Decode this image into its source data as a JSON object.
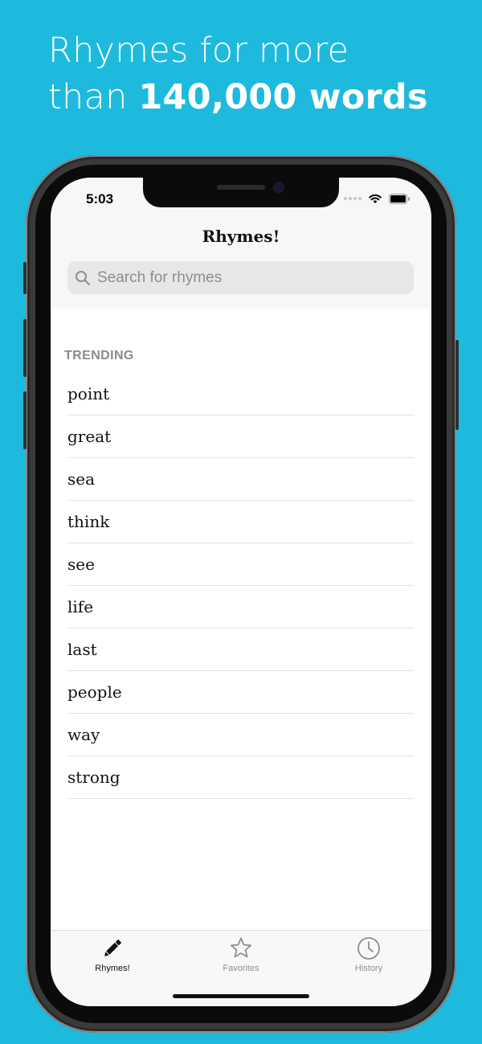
{
  "headline": {
    "line1": "Rhymes for more",
    "line2_regular": "than ",
    "line2_bold": "140,000 words"
  },
  "status_bar": {
    "time": "5:03",
    "icons": [
      "signal-dots-icon",
      "wifi-icon",
      "battery-icon"
    ]
  },
  "nav": {
    "title": "Rhymes!"
  },
  "search": {
    "placeholder": "Search for rhymes",
    "icon": "search-icon"
  },
  "trending": {
    "header": "TRENDING",
    "items": [
      "point",
      "great",
      "sea",
      "think",
      "see",
      "life",
      "last",
      "people",
      "way",
      "strong"
    ]
  },
  "tabbar": {
    "tabs": [
      {
        "label": "Rhymes!",
        "icon": "pencil-icon",
        "active": true
      },
      {
        "label": "Favorites",
        "icon": "star-icon",
        "active": false
      },
      {
        "label": "History",
        "icon": "clock-icon",
        "active": false
      }
    ]
  },
  "colors": {
    "background": "#1ebade",
    "active_tab": "#111111",
    "inactive_tab": "#8e8e93",
    "section_header": "#8a8a8f"
  }
}
